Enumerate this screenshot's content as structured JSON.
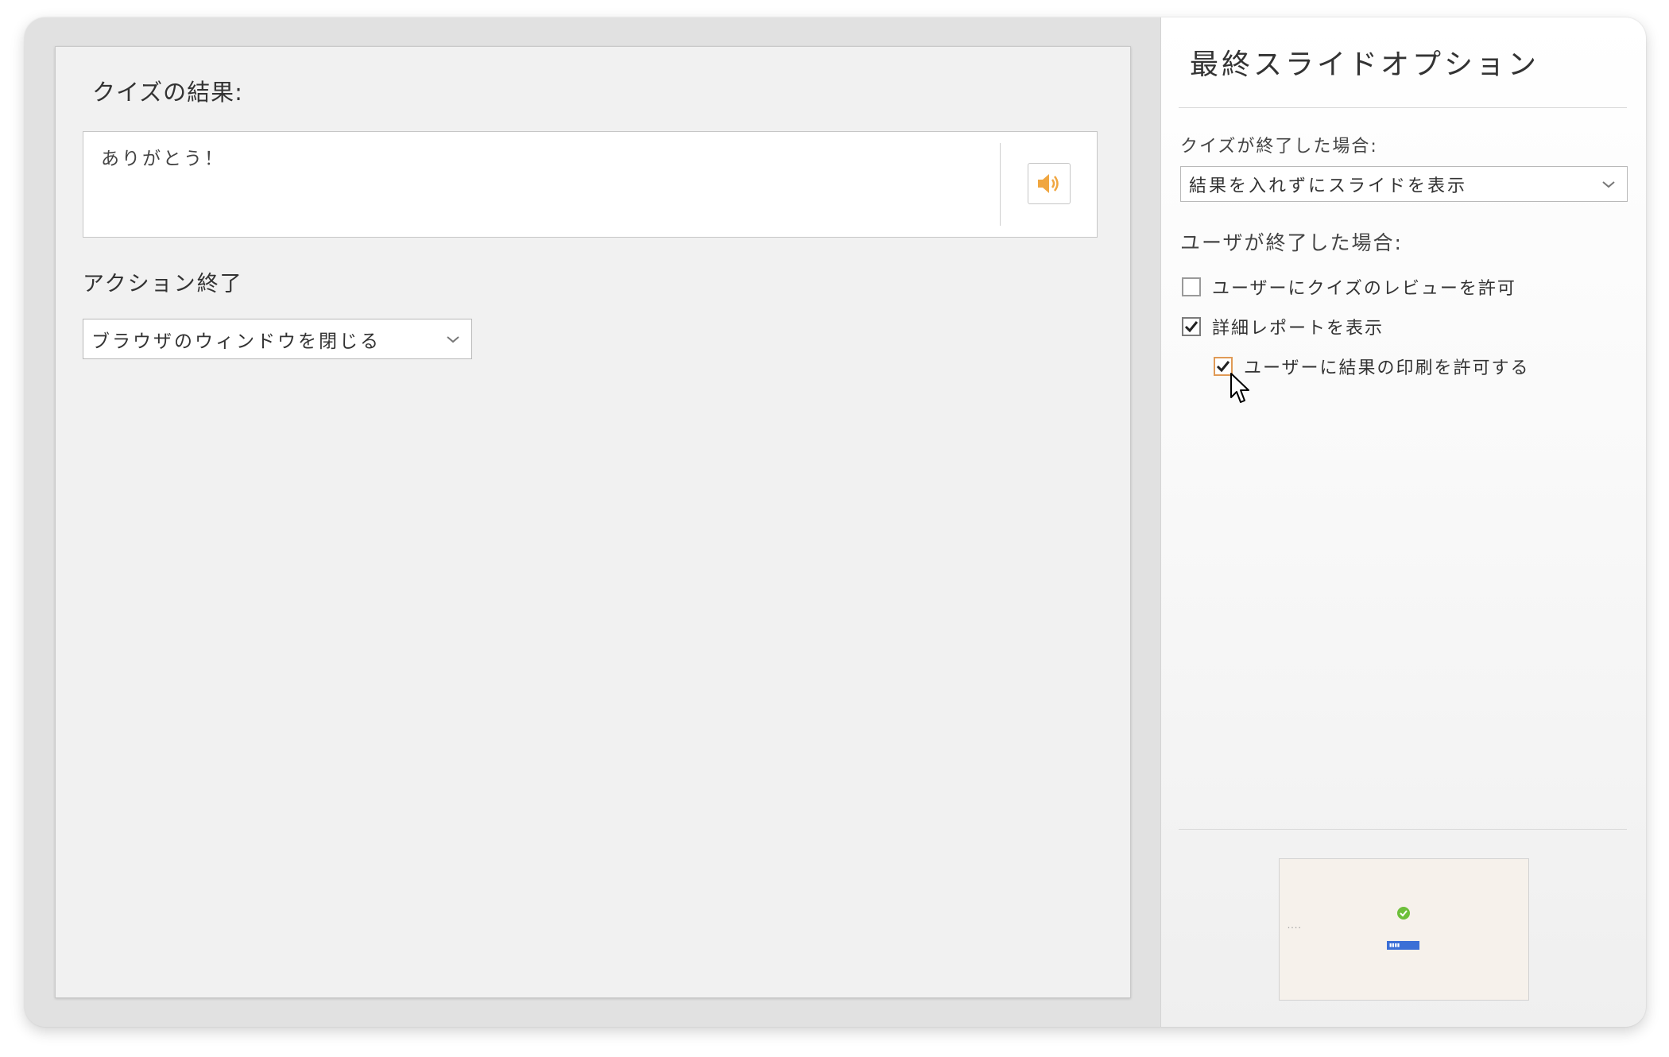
{
  "slide": {
    "quiz_results_label": "クイズの結果:",
    "message_text": "ありがとう！",
    "audio_icon": "speaker-icon",
    "end_action_label": "アクション終了",
    "end_action_value": "ブラウザのウィンドウを閉じる"
  },
  "options_panel": {
    "title": "最終スライドオプション",
    "quiz_finished_label": "クイズが終了した場合:",
    "quiz_finished_value": "結果を入れずにスライドを表示",
    "user_finished_label": "ユーザが終了した場合:",
    "options": [
      {
        "label": "ユーザーにクイズのレビューを許可",
        "checked": false
      },
      {
        "label": "詳細レポートを表示",
        "checked": true
      },
      {
        "label": "ユーザーに結果の印刷を許可する",
        "checked": true
      }
    ]
  },
  "colors": {
    "accent_orange": "#e09a56",
    "speaker_orange": "#f0a640",
    "thumb_check_green": "#6dbf3a",
    "thumb_button_blue": "#3b6fd6"
  }
}
